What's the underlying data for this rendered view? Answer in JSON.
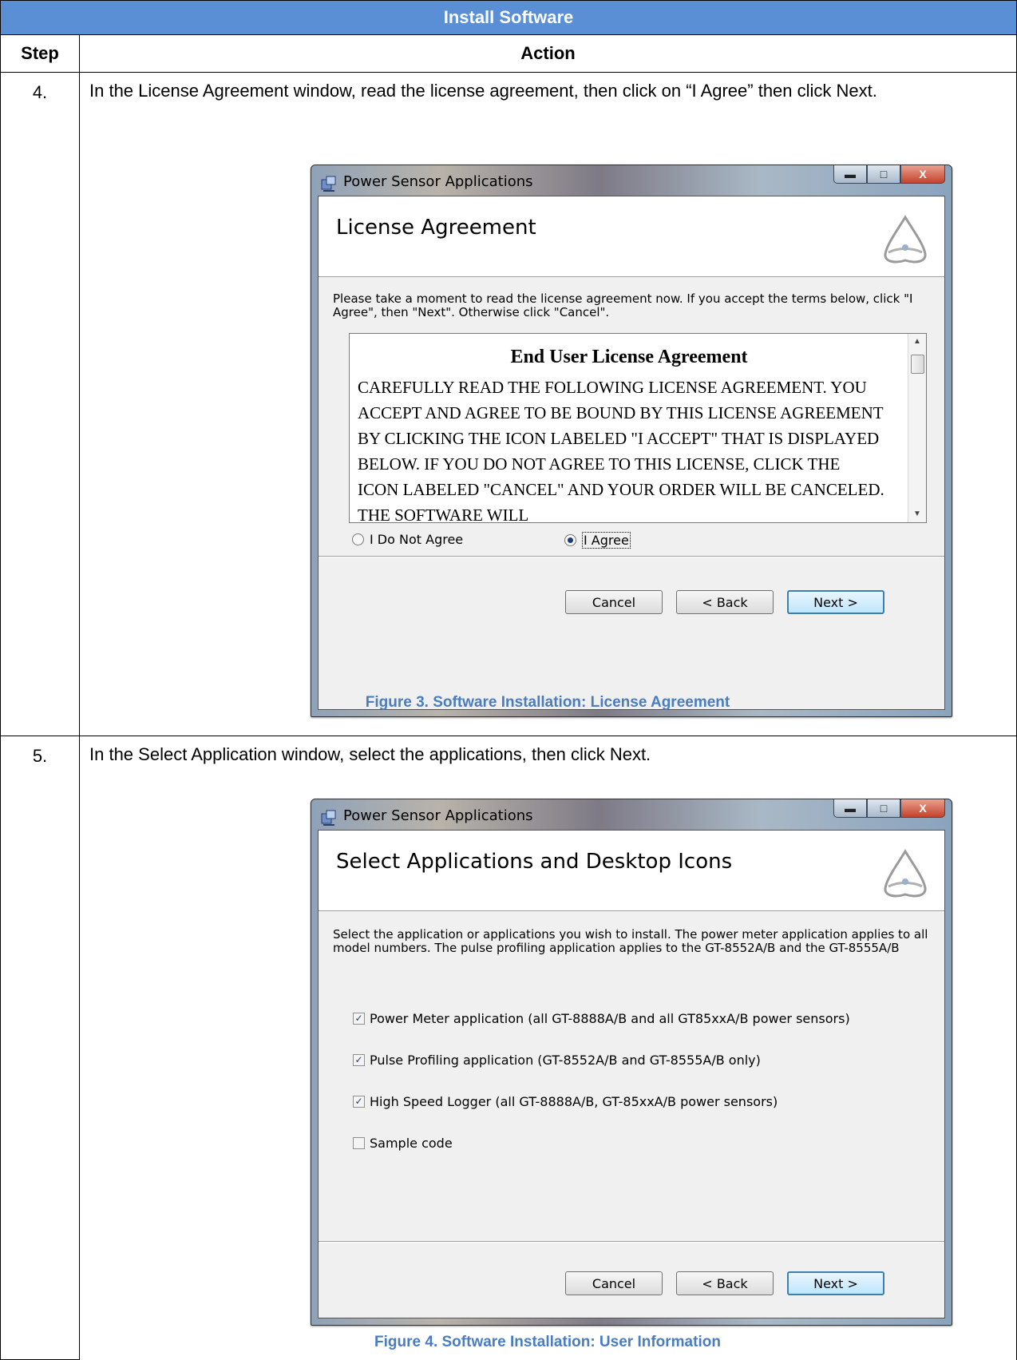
{
  "table": {
    "title": "Install Software",
    "col_step": "Step",
    "col_action": "Action"
  },
  "rows": [
    {
      "step": "4.",
      "action": "In the License Agreement window, read the license agreement, then click on “I Agree” then click Next.",
      "caption": "Figure 3. Software Installation: License Agreement"
    },
    {
      "step": "5.",
      "action": "In the Select Application window, select the applications, then click Next.",
      "caption": "Figure 4. Software Installation: User Information"
    }
  ],
  "win1": {
    "title": "Power Sensor Applications",
    "heading": "License Agreement",
    "intro": "Please take a moment to read the license agreement now. If you accept the terms below, click \"I Agree\", then \"Next\". Otherwise click \"Cancel\".",
    "license_title": "End User License Agreement",
    "license_text": "CAREFULLY READ THE FOLLOWING LICENSE AGREEMENT. YOU ACCEPT AND AGREE TO BE BOUND BY THIS LICENSE AGREEMENT BY CLICKING THE ICON LABELED \"I ACCEPT\" THAT IS DISPLAYED BELOW. IF YOU DO NOT AGREE TO THIS LICENSE, CLICK THE ICON LABELED \"CANCEL\" AND YOUR ORDER WILL BE CANCELED. THE SOFTWARE WILL",
    "radio_disagree": "I Do Not Agree",
    "radio_agree": "I Agree",
    "selected": "I Agree",
    "cancel": "Cancel",
    "back": "< Back",
    "next": "Next >"
  },
  "win2": {
    "title": "Power Sensor Applications",
    "heading": "Select Applications and Desktop Icons",
    "intro": "Select the application or applications you wish to install. The power meter application applies to all model numbers. The pulse profiling application applies to the GT-8552A/B and the GT-8555A/B",
    "options": [
      {
        "label": "Power Meter application (all GT-8888A/B and  all GT85xxA/B power sensors)",
        "checked": true
      },
      {
        "label": "Pulse Profiling application (GT-8552A/B and GT-8555A/B only)",
        "checked": true
      },
      {
        "label": "High Speed Logger (all GT-8888A/B, GT-85xxA/B power sensors)",
        "checked": true
      },
      {
        "label": "Sample code",
        "checked": false
      }
    ],
    "cancel": "Cancel",
    "back": "< Back",
    "next": "Next >"
  },
  "colors": {
    "header_bg": "#5a8fd6",
    "caption": "#4a7dbf"
  }
}
